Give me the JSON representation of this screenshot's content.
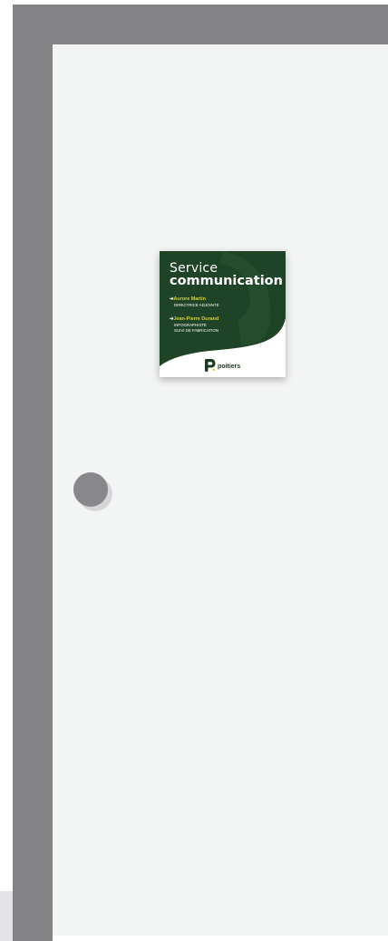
{
  "sign": {
    "title_line1": "Service",
    "title_line2": "communication",
    "people": [
      {
        "name": "Aurore Martin",
        "roles": [
          "DIRECTRICE ADJOINTE"
        ]
      },
      {
        "name": "Jean-Pierre Durand",
        "roles": [
          "INFOGRAPHISTE",
          "SUIVI DE FABRICATION"
        ]
      }
    ],
    "logo_text": "poitiers",
    "logo_icon": "poitiers-p-logo-icon"
  },
  "colors": {
    "frame_gray": "#838386",
    "panel_bg": "#f3f4f4",
    "sign_green": "#1f4326",
    "name_yellow": "#d6d132",
    "dot_gray": "#88888c"
  }
}
